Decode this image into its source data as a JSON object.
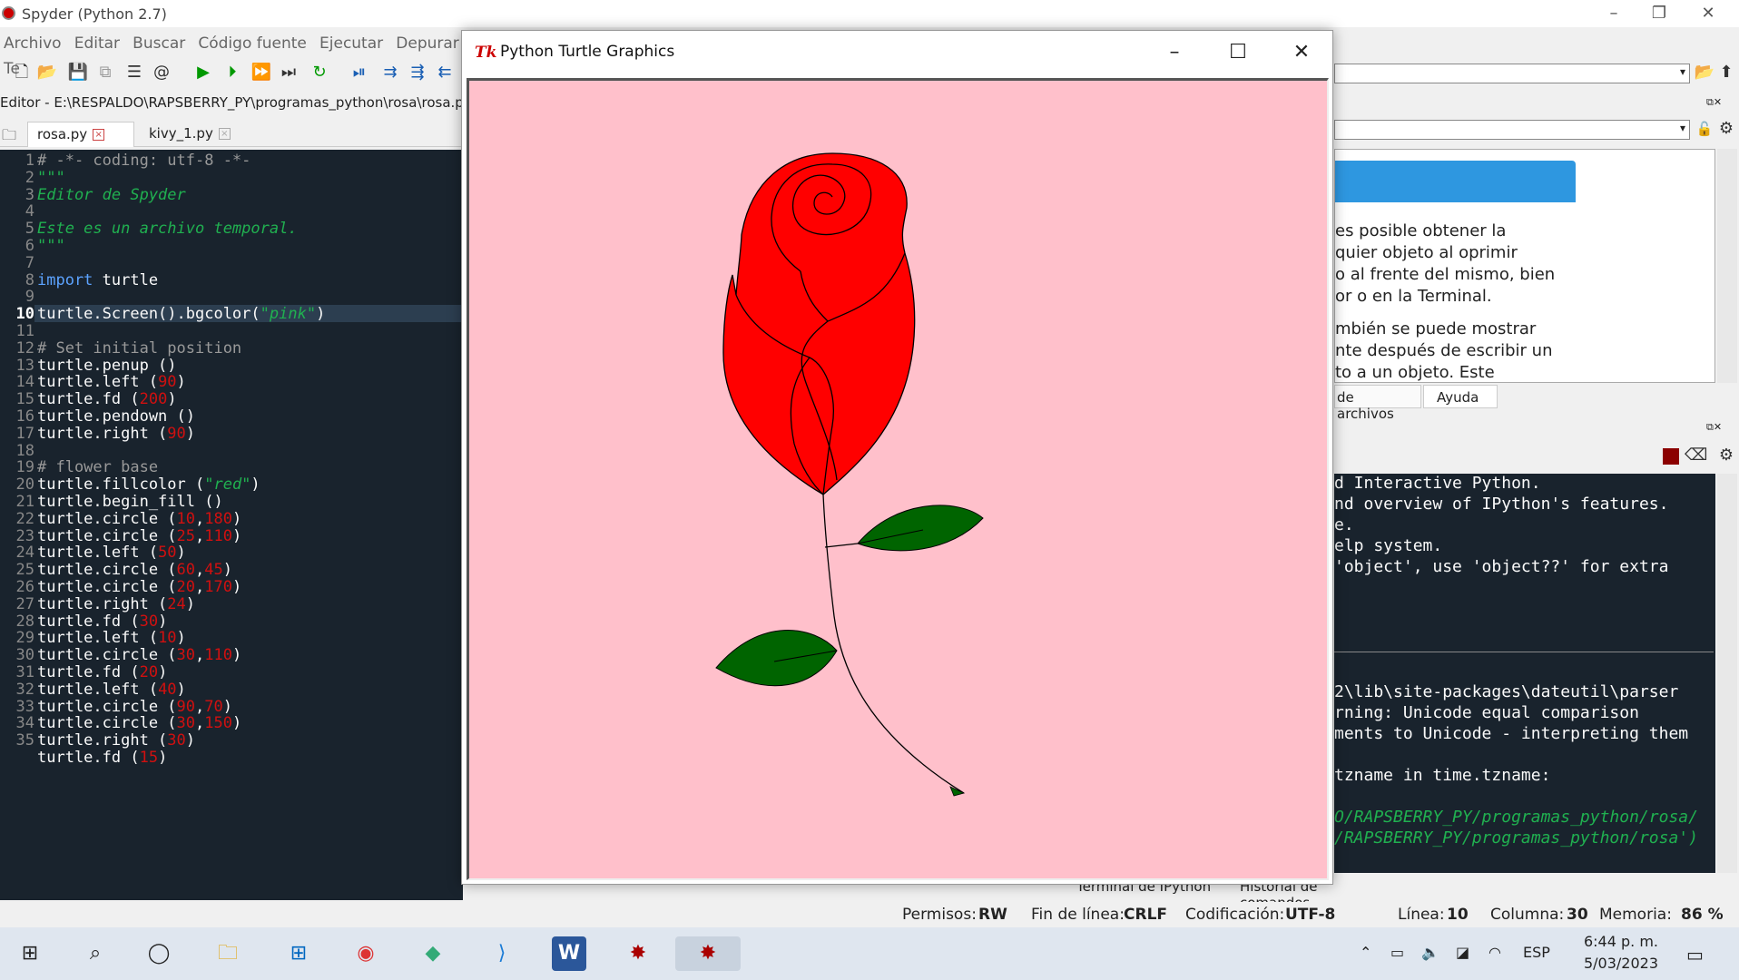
{
  "app": {
    "title": "Spyder (Python 2.7)",
    "menu": [
      "Archivo",
      "Editar",
      "Buscar",
      "Código fuente",
      "Ejecutar",
      "Depurar",
      "Te"
    ],
    "editor_path": "Editor - E:\\RESPALDO\\RAPSBERRY_PY\\programas_python\\rosa\\rosa.py",
    "tabs": [
      {
        "label": "rosa.py",
        "active": true
      },
      {
        "label": "kivy_1.py",
        "active": false
      }
    ]
  },
  "editor": {
    "current_line": 10,
    "lines": [
      "1",
      "2",
      "3",
      "4",
      "5",
      "6",
      "7",
      "8",
      "9",
      "10",
      "11",
      "12",
      "13",
      "14",
      "15",
      "16",
      "17",
      "18",
      "19",
      "20",
      "21",
      "22",
      "23",
      "24",
      "25",
      "26",
      "27",
      "28",
      "29",
      "30",
      "31",
      "32",
      "33",
      "34",
      "35"
    ]
  },
  "help_pane": {
    "lines": [
      "es posible obtener la",
      "quier objeto al oprimir",
      "o al frente del mismo, bien",
      "or o en la Terminal.",
      "mbién se puede mostrar",
      "nte después de escribir un",
      "to a un objeto. Este"
    ],
    "tabs": [
      "de archivos",
      "Ayuda"
    ]
  },
  "console": {
    "lines": [
      "d Interactive Python.",
      "nd overview of IPython's features.",
      "e.",
      "elp system.",
      "'object', use 'object??' for extra",
      "2\\lib\\site-packages\\dateutil\\parser",
      "rning: Unicode equal comparison",
      "ments to Unicode - interpreting them",
      "tzname in time.tzname:",
      "O/RAPSBERRY_PY/programas_python/rosa/",
      "/RAPSBERRY_PY/programas_python/rosa')"
    ],
    "bottom_tabs": [
      "Terminal de IPython",
      "Historial de comandos"
    ]
  },
  "statusbar": {
    "permisos_label": "Permisos:",
    "permisos": "RW",
    "eol_label": "Fin de línea:",
    "eol": "CRLF",
    "enc_label": "Codificación:",
    "enc": "UTF-8",
    "line_label": "Línea:",
    "line": "10",
    "col_label": "Columna:",
    "col": "30",
    "mem_label": "Memoria:",
    "mem": "86 %"
  },
  "turtle_window": {
    "title": "Python Turtle Graphics",
    "icon": "Tk",
    "bgcolor": "#ffc0cb",
    "fill": "#ff0000",
    "leaf": "#006400"
  },
  "taskbar": {
    "lang": "ESP",
    "time": "6:44 p. m.",
    "date": "5/03/2023"
  }
}
